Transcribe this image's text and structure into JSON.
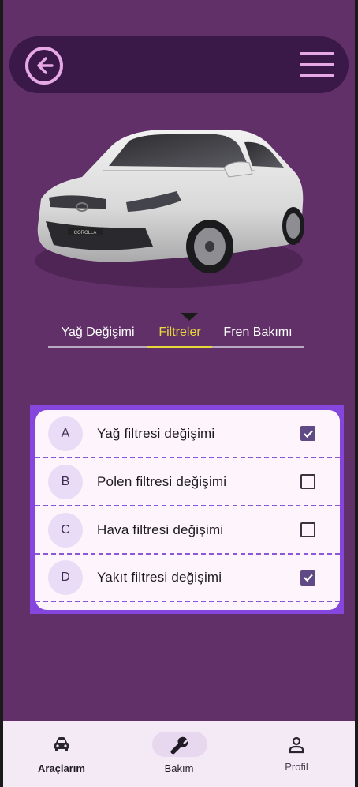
{
  "header": {
    "back_icon": "arrow-left-circle-icon",
    "menu_icon": "hamburger-menu-icon"
  },
  "hero": {
    "image": "white-toyota-corolla-sedan",
    "plate_text": "COROLLA"
  },
  "tabs": [
    {
      "label": "Yağ Değişimi",
      "active": false
    },
    {
      "label": "Filtreler",
      "active": true
    },
    {
      "label": "Fren Bakımı",
      "active": false
    }
  ],
  "filters": [
    {
      "letter": "A",
      "label": "Yağ filtresi değişimi",
      "checked": true
    },
    {
      "letter": "B",
      "label": "Polen filtresi değişimi",
      "checked": false
    },
    {
      "letter": "C",
      "label": "Hava filtresi değişimi",
      "checked": false
    },
    {
      "letter": "D",
      "label": "Yakıt filtresi değişimi",
      "checked": true
    }
  ],
  "bottom_nav": [
    {
      "label": "Araçlarım",
      "icon": "car-icon",
      "selected": false,
      "bold": true
    },
    {
      "label": "Bakım",
      "icon": "wrench-icon",
      "selected": true,
      "bold": false
    },
    {
      "label": "Profil",
      "icon": "person-icon",
      "selected": false,
      "bold": false
    }
  ],
  "colors": {
    "background": "#623068",
    "topbar": "#3a1848",
    "accent_icon": "#e7a8e6",
    "active_tab": "#e6d83a",
    "list_border": "#8446dc",
    "checkbox_on": "#5f4a86"
  }
}
